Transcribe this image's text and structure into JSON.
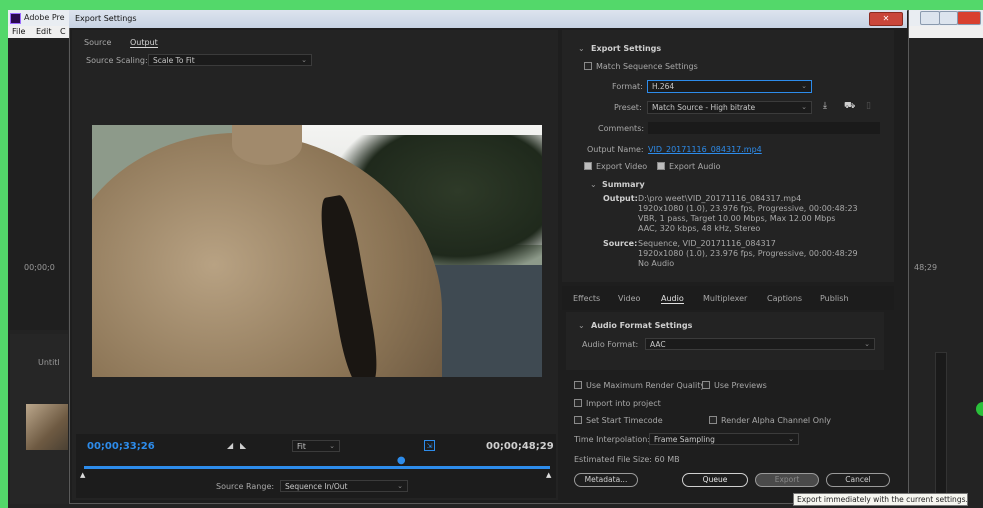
{
  "app": {
    "title": "Adobe Pre",
    "menu": [
      "File",
      "Edit",
      "C"
    ],
    "left_timecode": "00;00;0",
    "right_timecode": "48;29",
    "project_item": "Untitl"
  },
  "dialog": {
    "title": "Export Settings",
    "tabs": [
      "Source",
      "Output"
    ],
    "source_scaling_label": "Source Scaling:",
    "source_scaling_value": "Scale To Fit",
    "timecode_in": "00;00;33;26",
    "timecode_out": "00;00;48;29",
    "fit_value": "Fit",
    "source_range_label": "Source Range:",
    "source_range_value": "Sequence In/Out",
    "playhead_fraction": 0.68
  },
  "export_settings": {
    "header": "Export Settings",
    "match_sequence": "Match Sequence Settings",
    "format_label": "Format:",
    "format_value": "H.264",
    "preset_label": "Preset:",
    "preset_value": "Match Source - High bitrate",
    "comments_label": "Comments:",
    "output_name_label": "Output Name:",
    "output_name_value": "VID_20171116_084317.mp4",
    "export_video": "Export Video",
    "export_audio": "Export Audio",
    "summary_header": "Summary",
    "output_label": "Output:",
    "output_lines": [
      "D:\\pro weet\\VID_20171116_084317.mp4",
      "1920x1080 (1.0), 23.976 fps, Progressive, 00:00:48:23",
      "VBR, 1 pass, Target 10.00 Mbps, Max 12.00 Mbps",
      "AAC, 320 kbps, 48 kHz, Stereo"
    ],
    "source_label": "Source:",
    "source_lines": [
      "Sequence, VID_20171116_084317",
      "1920x1080 (1.0), 23.976 fps, Progressive, 00:00:48:29",
      "No Audio"
    ]
  },
  "tabs2": [
    "Effects",
    "Video",
    "Audio",
    "Multiplexer",
    "Captions",
    "Publish"
  ],
  "audio": {
    "header": "Audio Format Settings",
    "format_label": "Audio Format:",
    "format_value": "AAC"
  },
  "bottom": {
    "max_render": "Use Maximum Render Quality",
    "use_previews": "Use Previews",
    "import_project": "Import into project",
    "set_start_tc": "Set Start Timecode",
    "render_alpha": "Render Alpha Channel Only",
    "time_interp_label": "Time Interpolation:",
    "time_interp_value": "Frame Sampling",
    "est_size": "Estimated File Size:  60 MB",
    "metadata": "Metadata...",
    "queue": "Queue",
    "export": "Export",
    "cancel": "Cancel"
  },
  "tooltip": "Export immediately with the current settings."
}
